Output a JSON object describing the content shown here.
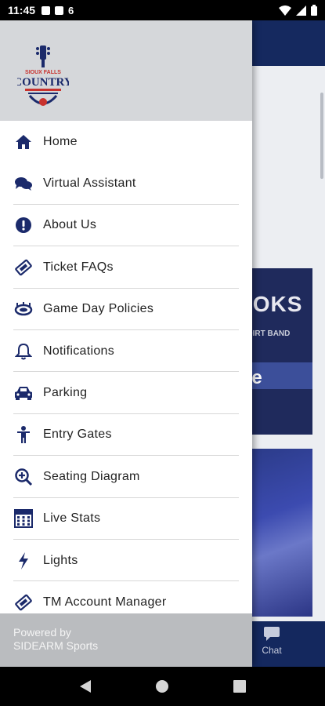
{
  "status_bar": {
    "time": "11:45"
  },
  "background": {
    "chat_label": "Chat",
    "card_title": "OOKS",
    "card_subtitle": "TY DIRT BAND",
    "card_band_text": "ate"
  },
  "drawer": {
    "logo_top": "SIOUX FALLS",
    "logo_main": "COUNTRY",
    "menu": [
      {
        "label": "Home",
        "icon": "home-icon"
      },
      {
        "label": "Virtual Assistant",
        "icon": "chat-bubbles-icon"
      },
      {
        "label": "About Us",
        "icon": "info-exclamation-icon"
      },
      {
        "label": "Ticket FAQs",
        "icon": "ticket-icon"
      },
      {
        "label": "Game Day Policies",
        "icon": "stadium-icon"
      },
      {
        "label": "Notifications",
        "icon": "bell-icon"
      },
      {
        "label": "Parking",
        "icon": "car-icon"
      },
      {
        "label": "Entry Gates",
        "icon": "person-icon"
      },
      {
        "label": "Seating Diagram",
        "icon": "zoom-in-icon"
      },
      {
        "label": "Live Stats",
        "icon": "calculator-icon"
      },
      {
        "label": "Lights",
        "icon": "lightning-icon"
      },
      {
        "label": "TM Account Manager",
        "icon": "ticket-icon"
      }
    ],
    "footer_line1": "Powered by",
    "footer_line2": "SIDEARM Sports"
  },
  "colors": {
    "brand": "#1b2a6b",
    "header": "#d5d7da",
    "footer": "#babcbf"
  }
}
